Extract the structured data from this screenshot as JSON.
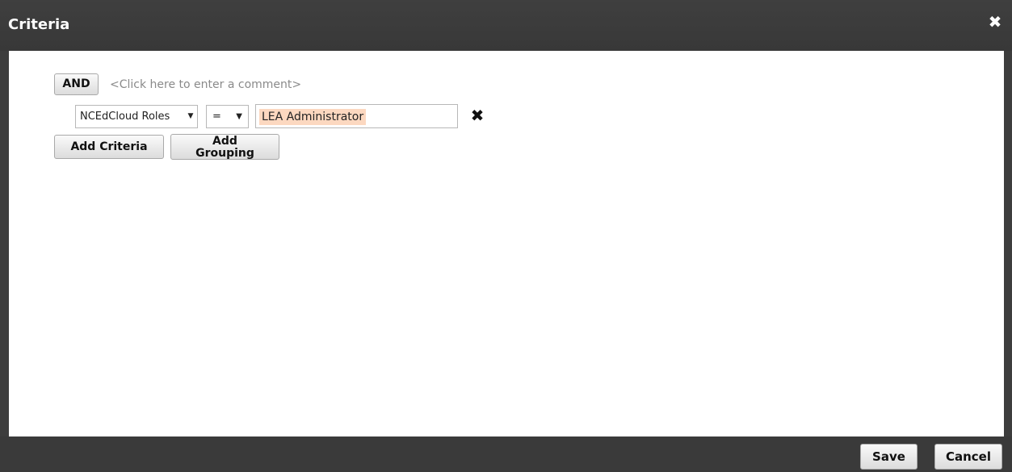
{
  "dialog": {
    "title": "Criteria",
    "close_icon": "close-icon"
  },
  "criteria": {
    "group_operator": "AND",
    "comment_placeholder": "<Click here to enter a comment>",
    "rows": [
      {
        "field": "NCEdCloud Roles",
        "operator": "=",
        "value": "LEA Administrator",
        "remove_icon": "remove-icon"
      }
    ],
    "add_criteria_label": "Add Criteria",
    "add_grouping_line1": "Add",
    "add_grouping_line2": "Grouping"
  },
  "footer": {
    "save_label": "Save",
    "cancel_label": "Cancel"
  },
  "colors": {
    "titlebar": "#3d3d3d",
    "content_bg": "#ffffff",
    "value_highlight": "#fcd8c0"
  }
}
